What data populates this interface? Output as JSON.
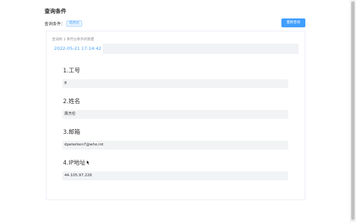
{
  "query": {
    "title": "查询条件",
    "condition_label": "查询条件：",
    "condition_tag": "周杰伦",
    "requery_label": "重新查询"
  },
  "results": {
    "summary": "查询到 1 条符合条件的数据",
    "tabs": [
      "2022-05-21 17:14:42"
    ],
    "fields": [
      {
        "label": "1.工号",
        "value": "8"
      },
      {
        "label": "2.姓名",
        "value": "周杰伦"
      },
      {
        "label": "3.邮箱",
        "value": "dpeterken7@who.int"
      },
      {
        "label": "4.IP地址",
        "value": "44.105.97.226"
      }
    ]
  },
  "colors": {
    "accent": "#409eff",
    "field_bg": "#f2f3f5",
    "tab_bar_bg": "#f0f2f5"
  }
}
